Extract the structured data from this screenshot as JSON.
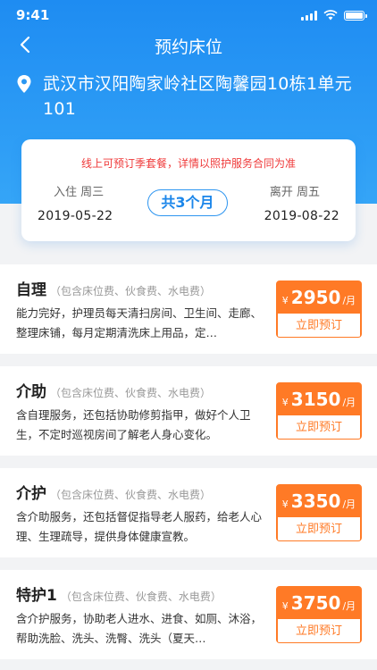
{
  "status_bar": {
    "time": "9:41"
  },
  "navbar": {
    "title": "预约床位"
  },
  "address": "武汉市汉阳陶家岭社区陶馨园10栋1单元101",
  "stay": {
    "notice": "线上可预订季套餐，详情以照护服务合同为准",
    "check_in_label": "入住 周三",
    "check_in_date": "2019-05-22",
    "duration": "共3个月",
    "check_out_label": "离开 周五",
    "check_out_date": "2019-08-22"
  },
  "plans": [
    {
      "name": "自理",
      "sub": "（包含床位费、伙食费、水电费）",
      "desc": "能力完好，护理员每天清扫房间、卫生间、走廊、整理床铺，每月定期清洗床上用品，定…",
      "currency": "¥",
      "price": "2950",
      "unit": "/月",
      "book": "立即预订"
    },
    {
      "name": "介助",
      "sub": "（包含床位费、伙食费、水电费）",
      "desc": "含自理服务，还包括协助修剪指甲，做好个人卫生，不定时巡视房间了解老人身心变化。",
      "currency": "¥",
      "price": "3150",
      "unit": "/月",
      "book": "立即预订"
    },
    {
      "name": "介护",
      "sub": "（包含床位费、伙食费、水电费）",
      "desc": "含介助服务，还包括督促指导老人服药，给老人心理、生理疏导，提供身体健康宣教。",
      "currency": "¥",
      "price": "3350",
      "unit": "/月",
      "book": "立即预订"
    },
    {
      "name": "特护1",
      "sub": "（包含床位费、伙食费、水电费）",
      "desc": "含介护服务，协助老人进水、进食、如厕、沐浴，帮助洗脸、洗头、洗臀、洗头（夏天…",
      "currency": "¥",
      "price": "3750",
      "unit": "/月",
      "book": "立即预订"
    }
  ],
  "colors": {
    "header_blue": "#1e8cf2",
    "accent_orange": "#ff7a26",
    "notice_red": "#ef3a3a"
  }
}
